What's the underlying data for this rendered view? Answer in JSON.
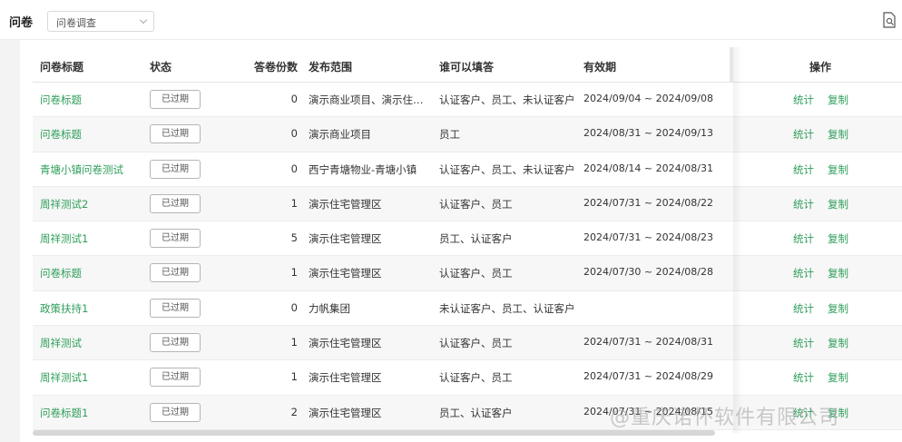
{
  "header": {
    "title": "问卷",
    "select_value": "问卷调查"
  },
  "table": {
    "columns": {
      "title": "问卷标题",
      "status": "状态",
      "count": "答卷份数",
      "scope": "发布范围",
      "who": "谁可以填答",
      "period": "有效期",
      "ops": "操作"
    },
    "rows": [
      {
        "title": "问卷标题",
        "status": "已过期",
        "count": "0",
        "scope": "演示商业项目、演示住…",
        "who": "认证客户、员工、未认证客户",
        "period": "2024/09/04 ~ 2024/09/08",
        "stat": "统计",
        "copy": "复制"
      },
      {
        "title": "问卷标题",
        "status": "已过期",
        "count": "0",
        "scope": "演示商业项目",
        "who": "员工",
        "period": "2024/08/31 ~ 2024/09/13",
        "stat": "统计",
        "copy": "复制"
      },
      {
        "title": "青塘小镇问卷测试",
        "status": "已过期",
        "count": "0",
        "scope": "西宁青塘物业-青塘小镇",
        "who": "认证客户、员工、未认证客户",
        "period": "2024/08/14 ~ 2024/08/31",
        "stat": "统计",
        "copy": "复制"
      },
      {
        "title": "周祥测试2",
        "status": "已过期",
        "count": "1",
        "scope": "演示住宅管理区",
        "who": "认证客户、员工",
        "period": "2024/07/31 ~ 2024/08/22",
        "stat": "统计",
        "copy": "复制"
      },
      {
        "title": "周祥测试1",
        "status": "已过期",
        "count": "5",
        "scope": "演示住宅管理区",
        "who": "员工、认证客户",
        "period": "2024/07/31 ~ 2024/08/23",
        "stat": "统计",
        "copy": "复制"
      },
      {
        "title": "问卷标题",
        "status": "已过期",
        "count": "1",
        "scope": "演示住宅管理区",
        "who": "认证客户、员工",
        "period": "2024/07/30 ~ 2024/08/28",
        "stat": "统计",
        "copy": "复制"
      },
      {
        "title": "政策扶持1",
        "status": "已过期",
        "count": "0",
        "scope": "力帆集团",
        "who": "未认证客户、员工、认证客户",
        "period": "",
        "stat": "统计",
        "copy": "复制"
      },
      {
        "title": "周祥测试",
        "status": "已过期",
        "count": "1",
        "scope": "演示住宅管理区",
        "who": "认证客户、员工",
        "period": "2024/07/31 ~ 2024/08/31",
        "stat": "统计",
        "copy": "复制"
      },
      {
        "title": "周祥测试1",
        "status": "已过期",
        "count": "1",
        "scope": "演示住宅管理区",
        "who": "认证客户、员工",
        "period": "2024/07/31 ~ 2024/08/29",
        "stat": "统计",
        "copy": "复制"
      },
      {
        "title": "问卷标题1",
        "status": "已过期",
        "count": "2",
        "scope": "演示住宅管理区",
        "who": "员工、认证客户",
        "period": "2024/07/31 ~ 2024/08/15",
        "stat": "统计",
        "copy": "复制"
      }
    ]
  },
  "watermark": "@重庆诺怀软件有限公司"
}
